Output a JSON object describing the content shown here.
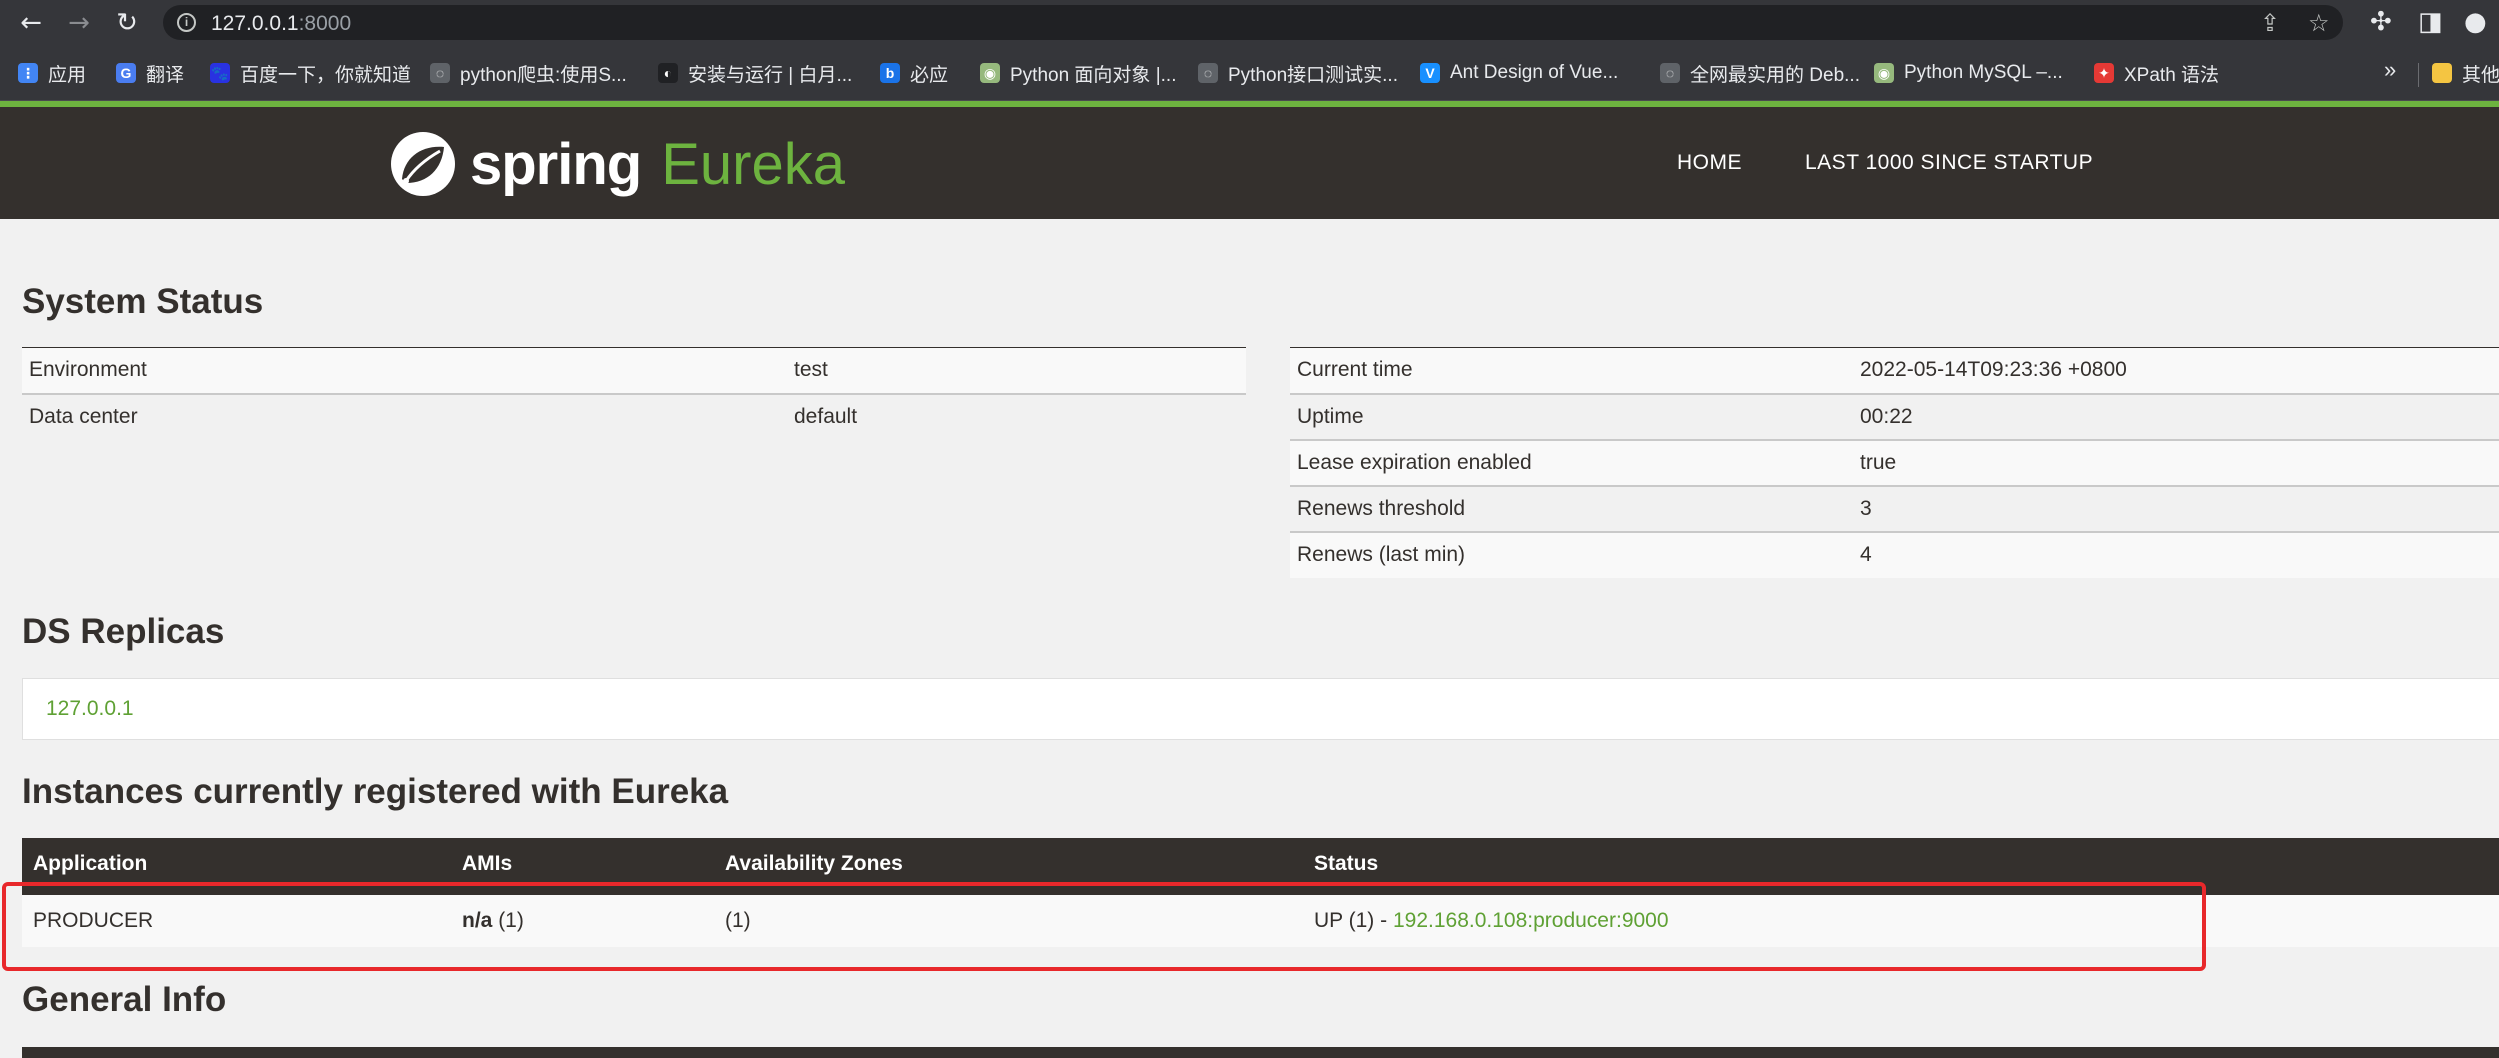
{
  "browser": {
    "url_host": "127.0.0.1",
    "url_port": ":8000",
    "icons": [
      "back-arrow-icon",
      "forward-arrow-icon",
      "reload-icon",
      "info-icon",
      "share-icon",
      "star-icon",
      "extensions-icon",
      "sidebar-icon",
      "profile-icon"
    ]
  },
  "bookmarks": {
    "items": [
      {
        "label": "应用",
        "icon": "apps-grid-icon",
        "color": "#4285f4"
      },
      {
        "label": "翻译",
        "icon": "translate-icon",
        "color": "#4a7df0"
      },
      {
        "label": "百度一下，你就知道",
        "icon": "baidu-icon",
        "color": "#2932e1"
      },
      {
        "label": "python爬虫:使用S...",
        "icon": "globe-icon",
        "color": "#5f6368"
      },
      {
        "label": "安装与运行 | 白月...",
        "icon": "site-icon",
        "color": "#202124"
      },
      {
        "label": "必应",
        "icon": "bing-icon",
        "color": "#1a73e8"
      },
      {
        "label": "Python 面向对象 |...",
        "icon": "runoob-icon",
        "color": "#96b97d"
      },
      {
        "label": "Python接口测试实...",
        "icon": "globe-icon",
        "color": "#5f6368"
      },
      {
        "label": "Ant Design of Vue...",
        "icon": "antd-icon",
        "color": "#1890ff"
      },
      {
        "label": "全网最实用的 Deb...",
        "icon": "globe-icon",
        "color": "#5f6368"
      },
      {
        "label": "Python MySQL –...",
        "icon": "runoob-icon",
        "color": "#96b97d"
      },
      {
        "label": "XPath 语法",
        "icon": "w3-icon",
        "color": "#e53935"
      }
    ],
    "more": "»",
    "other": "其他"
  },
  "header": {
    "logo_spring": "spring",
    "logo_eureka": "Eureka",
    "nav": [
      "HOME",
      "LAST 1000 SINCE STARTUP"
    ],
    "brand_color": "#6db33f",
    "bar_color": "#34302d"
  },
  "system_status": {
    "title": "System Status",
    "left": [
      [
        "Environment",
        "test"
      ],
      [
        "Data center",
        "default"
      ]
    ],
    "right": [
      [
        "Current time",
        "2022-05-14T09:23:36 +0800"
      ],
      [
        "Uptime",
        "00:22"
      ],
      [
        "Lease expiration enabled",
        "true"
      ],
      [
        "Renews threshold",
        "3"
      ],
      [
        "Renews (last min)",
        "4"
      ]
    ]
  },
  "ds_replicas": {
    "title": "DS Replicas",
    "items": [
      "127.0.0.1"
    ]
  },
  "instances": {
    "title": "Instances currently registered with Eureka",
    "columns": [
      "Application",
      "AMIs",
      "Availability Zones",
      "Status"
    ],
    "rows": [
      {
        "application": "PRODUCER",
        "ami_name": "n/a",
        "ami_count": "(1)",
        "zones": "(1)",
        "status_prefix": "UP (1) - ",
        "status_link": "192.168.0.108:producer:9000"
      }
    ],
    "highlight_color": "#e8282b"
  },
  "general_info": {
    "title": "General Info"
  }
}
